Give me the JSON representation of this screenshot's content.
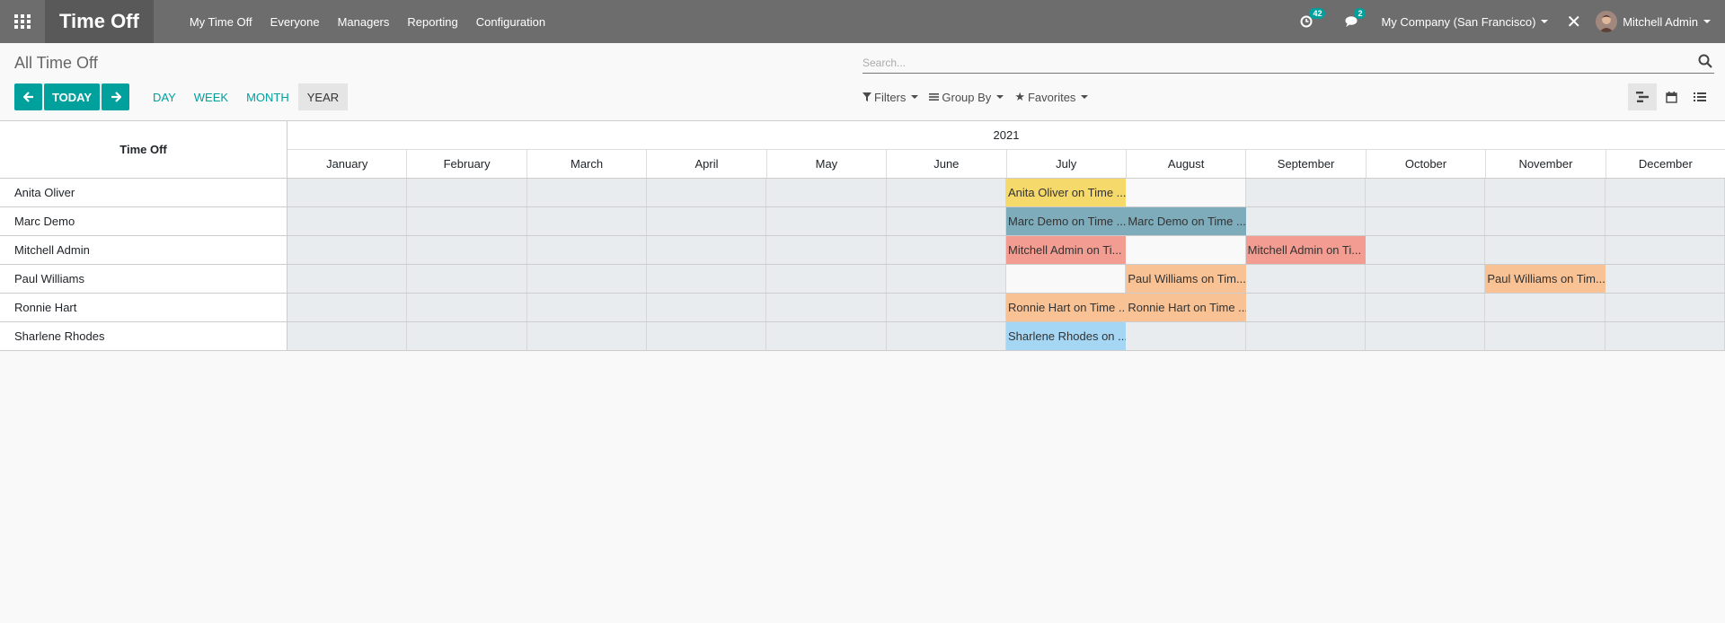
{
  "navbar": {
    "app_title": "Time Off",
    "menu": [
      "My Time Off",
      "Everyone",
      "Managers",
      "Reporting",
      "Configuration"
    ],
    "activity_count": "42",
    "message_count": "2",
    "company": "My Company (San Francisco)",
    "user": "Mitchell Admin"
  },
  "control_panel": {
    "breadcrumb": "All Time Off",
    "search_placeholder": "Search...",
    "today_label": "TODAY",
    "scales": [
      "DAY",
      "WEEK",
      "MONTH",
      "YEAR"
    ],
    "active_scale": "YEAR",
    "filters_label": "Filters",
    "groupby_label": "Group By",
    "favorites_label": "Favorites"
  },
  "gantt": {
    "row_header": "Time Off",
    "year": "2021",
    "months": [
      "January",
      "February",
      "March",
      "April",
      "May",
      "June",
      "July",
      "August",
      "September",
      "October",
      "November",
      "December"
    ],
    "rows": [
      {
        "name": "Anita Oliver",
        "pills": [
          {
            "month": 6,
            "label": "Anita Oliver on Time ...",
            "color": "#f6d96b"
          }
        ],
        "light": [
          7
        ]
      },
      {
        "name": "Marc Demo",
        "pills": [
          {
            "month": 6,
            "label": "Marc Demo on Time ...",
            "color": "#7eacbb"
          },
          {
            "month": 7,
            "label": "Marc Demo on Time ...",
            "color": "#7eacbb"
          }
        ],
        "light": []
      },
      {
        "name": "Mitchell Admin",
        "pills": [
          {
            "month": 6,
            "label": "Mitchell Admin on Ti...",
            "color": "#f39c91"
          },
          {
            "month": 8,
            "label": "Mitchell Admin on Ti...",
            "color": "#f39c91"
          }
        ],
        "light": [
          7
        ]
      },
      {
        "name": "Paul Williams",
        "pills": [
          {
            "month": 7,
            "label": "Paul Williams on Tim...",
            "color": "#f9c294"
          },
          {
            "month": 10,
            "label": "Paul Williams on Tim...",
            "color": "#f9c294"
          }
        ],
        "light": [
          6
        ]
      },
      {
        "name": "Ronnie Hart",
        "pills": [
          {
            "month": 6,
            "label": "Ronnie Hart on Time ...",
            "color": "#f9c294"
          },
          {
            "month": 7,
            "label": "Ronnie Hart on Time ...",
            "color": "#f9c294"
          }
        ],
        "light": []
      },
      {
        "name": "Sharlene Rhodes",
        "pills": [
          {
            "month": 6,
            "label": "Sharlene Rhodes on ...",
            "color": "#a5d7f4"
          }
        ],
        "light": []
      }
    ]
  }
}
